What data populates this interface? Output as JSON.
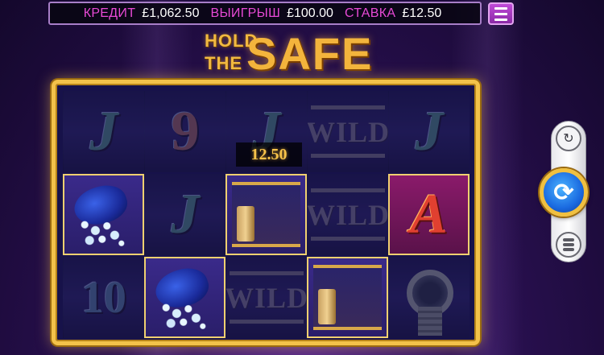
{
  "header": {
    "credit_label": "КРЕДИТ",
    "credit_value": "£1,062.50",
    "win_label": "ВЫИГРЫШ",
    "win_value": "£100.00",
    "bet_label": "СТАВКА",
    "bet_value": "£12.50",
    "menu_icon": "hamburger-menu-icon"
  },
  "logo": {
    "line1": "HOLD",
    "line2": "THE",
    "word": "SAFE"
  },
  "reels": {
    "win_amount": "12.50",
    "symbols": [
      [
        "J",
        "9",
        "J",
        "WILD",
        "J"
      ],
      [
        "bag-of-diamonds",
        "J",
        "safe",
        "WILD",
        "A"
      ],
      [
        "10",
        "bag-of-diamonds",
        "WILD",
        "safe",
        "watch"
      ]
    ]
  },
  "controls": {
    "autoplay_icon": "autoplay-icon",
    "spin_icon": "spin-arrows-icon",
    "coins_icon": "coin-stack-icon"
  },
  "colors": {
    "label_pink": "#e84ad6",
    "frame_gold": "#f3c24a",
    "spin_blue": "#1a6ae0"
  }
}
